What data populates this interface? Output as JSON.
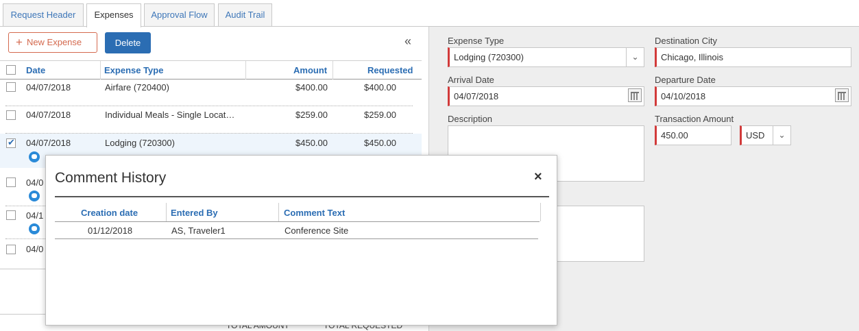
{
  "tabs": [
    {
      "label": "Request Header",
      "active": false
    },
    {
      "label": "Expenses",
      "active": true
    },
    {
      "label": "Approval Flow",
      "active": false
    },
    {
      "label": "Audit Trail",
      "active": false
    }
  ],
  "toolbar": {
    "new_expense_icon": "+",
    "new_expense_label": "New Expense",
    "delete_label": "Delete",
    "collapse_icon": "«"
  },
  "grid": {
    "columns": {
      "date": "Date",
      "expense_type": "Expense Type",
      "amount": "Amount",
      "requested": "Requested"
    },
    "rows": [
      {
        "date": "04/07/2018",
        "type": "Airfare (720400)",
        "amount": "$400.00",
        "requested": "$400.00"
      },
      {
        "date": "04/07/2018",
        "type": "Individual Meals - Single Locat…",
        "amount": "$259.00",
        "requested": "$259.00"
      },
      {
        "date": "04/07/2018",
        "type": "Lodging (720300)",
        "amount": "$450.00",
        "requested": "$450.00"
      },
      {
        "date": "04/0"
      },
      {
        "date": "04/1"
      },
      {
        "date": "04/0"
      }
    ]
  },
  "footer": {
    "total_amount": "TOTAL AMOUNT",
    "total_requested": "TOTAL REQUESTED"
  },
  "details": {
    "expense_type_label": "Expense Type",
    "expense_type_value": "Lodging (720300)",
    "destination_city_label": "Destination City",
    "destination_city_value": "Chicago, Illinois",
    "arrival_date_label": "Arrival Date",
    "arrival_date_value": "04/07/2018",
    "departure_date_label": "Departure Date",
    "departure_date_value": "04/10/2018",
    "description_label": "Description",
    "transaction_amount_label": "Transaction Amount",
    "transaction_amount_value": "450.00",
    "currency_value": "USD"
  },
  "modal": {
    "title": "Comment History",
    "close_icon": "×",
    "columns": {
      "creation_date": "Creation date",
      "entered_by": "Entered By",
      "comment_text": "Comment Text"
    },
    "rows": [
      {
        "creation_date": "01/12/2018",
        "entered_by": "AS, Traveler1",
        "comment_text": "Conference Site"
      }
    ]
  },
  "colors": {
    "accent": "#2b6db3",
    "required": "#d23a3a",
    "new_button": "#d4694e",
    "comment_icon": "#2a8ad8"
  }
}
